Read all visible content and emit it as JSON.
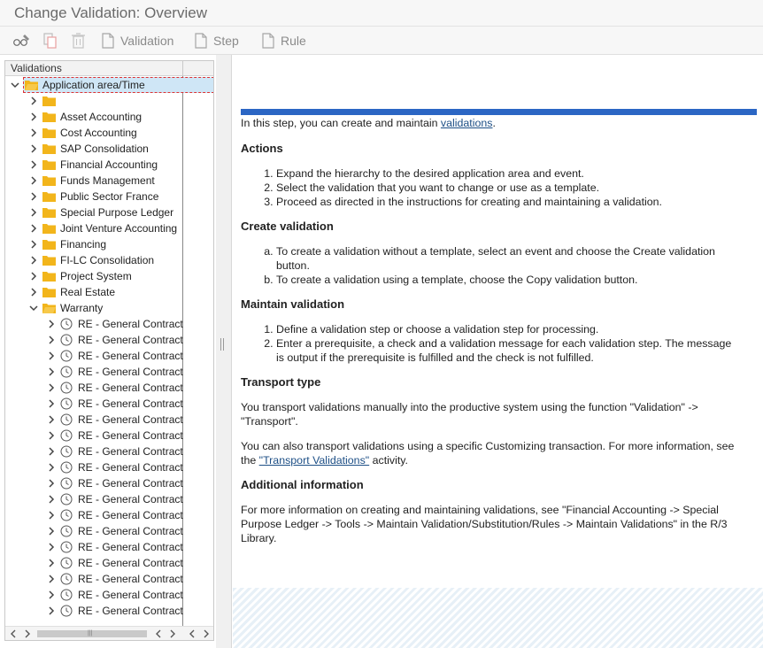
{
  "window": {
    "title": "Change Validation: Overview"
  },
  "toolbar": {
    "validation_label": "Validation",
    "step_label": "Step",
    "rule_label": "Rule"
  },
  "tree": {
    "header": "Validations",
    "root_label": "Application area/Time",
    "items": [
      "",
      "Asset Accounting",
      "Cost Accounting",
      "SAP Consolidation",
      "Financial Accounting",
      "Funds Management",
      "Public Sector France",
      "Special Purpose Ledger",
      "Joint Venture Accounting",
      "Financing",
      "FI-LC Consolidation",
      "Project System",
      "Real Estate"
    ],
    "expanded_item": "Warranty",
    "child_label": "RE - General Contract"
  },
  "doc": {
    "intro_before": "In this step, you can create and maintain ",
    "intro_link": "validations",
    "intro_after": ".",
    "actions_heading": "Actions",
    "actions": [
      "Expand the hierarchy to the desired application area and event.",
      "Select the validation that you want to change or use as a template.",
      "Proceed as directed in the instructions for creating and maintaining a validation."
    ],
    "create_heading": "Create validation",
    "create_items": [
      "To create a validation without a template, select an event and choose the Create validation button.",
      "To create a validation using a template, choose the Copy validation button."
    ],
    "maintain_heading": "Maintain validation",
    "maintain_items": [
      "Define a validation step or choose a validation step for processing.",
      "Enter a prerequisite, a check and a validation message for each validation step. The message is output if the prerequisite is fulfilled and the check is not fulfilled."
    ],
    "transport_heading": "Transport type",
    "transport_p1": "You transport validations manually into the productive system using the function \"Validation\" -> \"Transport\".",
    "transport_p2_before": "You can also transport validations using a specific Customizing transaction. For more information, see the ",
    "transport_p2_link": "\"Transport Validations\"",
    "transport_p2_after": " activity.",
    "additional_heading": "Additional information",
    "additional_p": "For more information on creating and maintaining validations, see \"Financial Accounting -> Special Purpose Ledger -> Tools -> Maintain Validation/Substitution/Rules -> Maintain Validations\" in the R/3 Library."
  },
  "colors": {
    "accent_bar": "#2b66c4",
    "folder": "#f2b51b",
    "selection": "#cfe6f6",
    "link": "#1d4f86"
  }
}
